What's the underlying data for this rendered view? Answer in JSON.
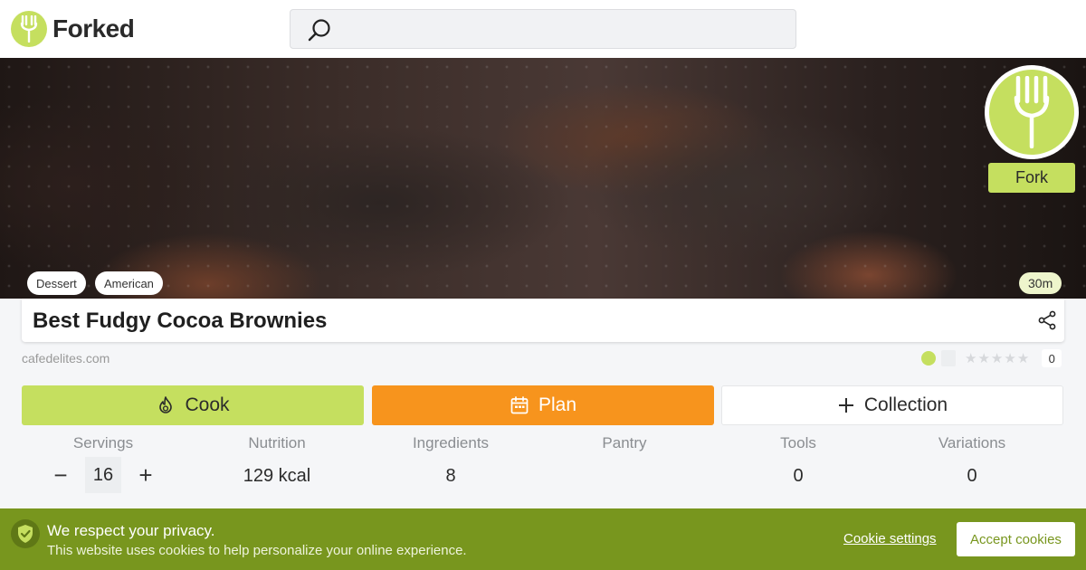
{
  "header": {
    "logo_text": "Forked",
    "search": {
      "placeholder": "",
      "value": ""
    }
  },
  "hero": {
    "fork_button_label": "Fork",
    "tags": [
      "Dessert",
      "American"
    ],
    "time": "30m"
  },
  "recipe": {
    "title": "Best Fudgy Cocoa Brownies",
    "source": "cafedelites.com",
    "rating": 0,
    "rating_count": "0"
  },
  "actions": {
    "cook": "Cook",
    "plan": "Plan",
    "collection": "Collection"
  },
  "stats": {
    "servings": {
      "label": "Servings",
      "value": "16",
      "minus": "−",
      "plus": "+"
    },
    "nutrition": {
      "label": "Nutrition",
      "value": "129 kcal"
    },
    "ingredients": {
      "label": "Ingredients",
      "value": "8"
    },
    "pantry": {
      "label": "Pantry",
      "value": ""
    },
    "tools": {
      "label": "Tools",
      "value": "0"
    },
    "variations": {
      "label": "Variations",
      "value": "0"
    }
  },
  "cookie_bar": {
    "title": "We respect your privacy.",
    "text": "This website uses cookies to help personalize your online experience.",
    "settings_link": "Cookie settings",
    "accept_button": "Accept cookies"
  },
  "colors": {
    "brand_green": "#c5df5f",
    "plan_orange": "#f7941d",
    "cookie_bar_green": "#78961e"
  },
  "icons": [
    "fork-icon",
    "search-icon",
    "share-icon",
    "flame-icon",
    "calendar-icon",
    "plus-icon",
    "shield-check-icon",
    "star-icon"
  ]
}
